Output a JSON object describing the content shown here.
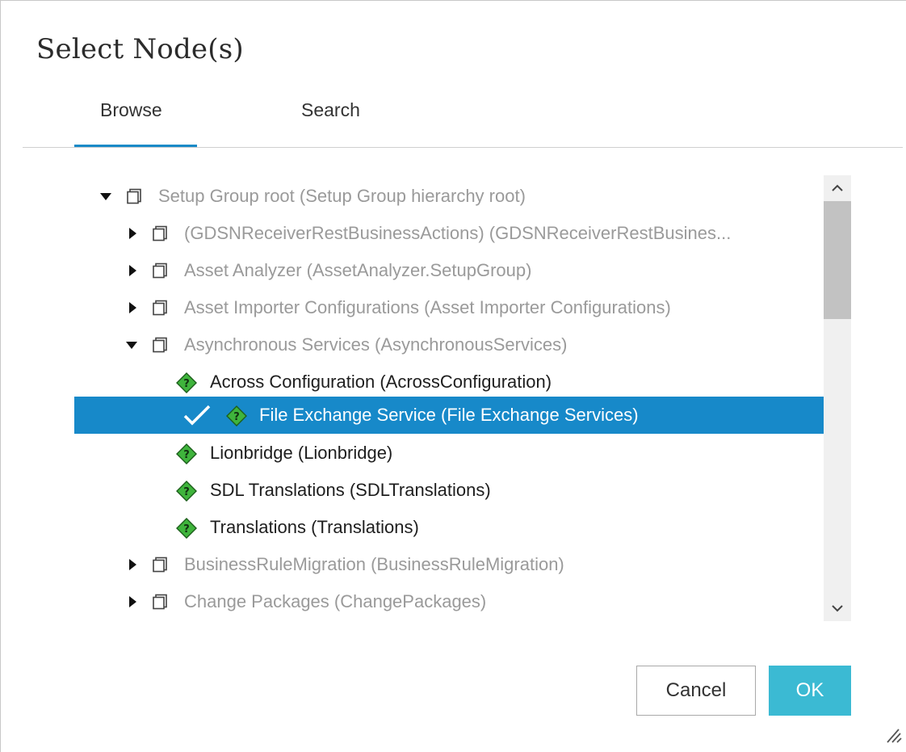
{
  "dialog": {
    "title": "Select Node(s)",
    "tabs": [
      {
        "label": "Browse",
        "active": true
      },
      {
        "label": "Search",
        "active": false
      }
    ],
    "tree": [
      {
        "label": "Setup Group root (Setup Group hierarchy root)",
        "expanded": true,
        "type": "folder",
        "enabled": false
      },
      {
        "label": "(GDSNReceiverRestBusinessActions) (GDSNReceiverRestBusines...",
        "expanded": false,
        "type": "folder",
        "enabled": false
      },
      {
        "label": "Asset Analyzer (AssetAnalyzer.SetupGroup)",
        "expanded": false,
        "type": "folder",
        "enabled": false
      },
      {
        "label": "Asset Importer Configurations (Asset Importer Configurations)",
        "expanded": false,
        "type": "folder",
        "enabled": false
      },
      {
        "label": "Asynchronous Services (AsynchronousServices)",
        "expanded": true,
        "type": "folder",
        "enabled": false
      },
      {
        "label": "Across Configuration (AcrossConfiguration)",
        "type": "node",
        "enabled": true
      },
      {
        "label": "File Exchange Service (File Exchange Services)",
        "type": "node",
        "enabled": true,
        "selected": true
      },
      {
        "label": "Lionbridge (Lionbridge)",
        "type": "node",
        "enabled": true
      },
      {
        "label": "SDL Translations (SDLTranslations)",
        "type": "node",
        "enabled": true
      },
      {
        "label": "Translations (Translations)",
        "type": "node",
        "enabled": true
      },
      {
        "label": "BusinessRuleMigration (BusinessRuleMigration)",
        "expanded": false,
        "type": "folder",
        "enabled": false
      },
      {
        "label": "Change Packages (ChangePackages)",
        "expanded": false,
        "type": "folder",
        "enabled": false
      }
    ],
    "buttons": {
      "cancel": "Cancel",
      "ok": "OK"
    },
    "icons": {
      "folder": "setup-group-folder-icon",
      "node": "green-diamond-question-icon",
      "check": "checkmark-icon"
    },
    "colors": {
      "accent": "#1a8ac7",
      "selection": "#1789c9",
      "ok_button": "#3bbad3",
      "disabled_text": "#9a9a9a"
    }
  }
}
